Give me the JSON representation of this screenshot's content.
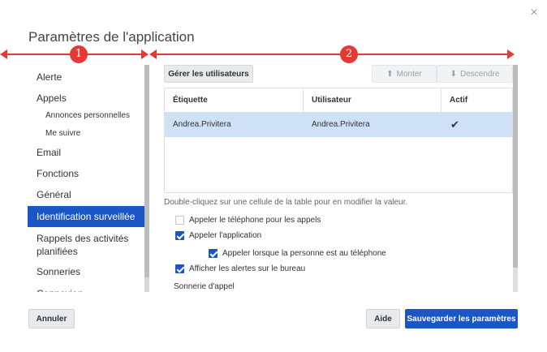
{
  "dialog": {
    "title": "Paramètres de l'application",
    "close_glyph": "×"
  },
  "annotations": [
    {
      "number": "1",
      "color": "#e53935"
    },
    {
      "number": "2",
      "color": "#e53935"
    }
  ],
  "sidebar": {
    "items": [
      {
        "label": "Alerte"
      },
      {
        "label": "Appels"
      },
      {
        "label": "Annonces personnelles"
      },
      {
        "label": "Me suivre"
      },
      {
        "label": "Email"
      },
      {
        "label": "Fonctions"
      },
      {
        "label": "Général"
      },
      {
        "label": "Identification surveillée"
      },
      {
        "label": "Rappels des activités planifiées"
      },
      {
        "label": "Sonneries"
      },
      {
        "label": "Connexion"
      }
    ],
    "active_index": 7,
    "active_color": "#1a56c4"
  },
  "toolbar": {
    "manage_label": "Gérer les utilisateurs",
    "up_label": "Monter",
    "down_label": "Descendre",
    "up_icon": "arrow-up-icon",
    "down_icon": "arrow-down-icon"
  },
  "table": {
    "headers": [
      "Étiquette",
      "Utilisateur",
      "Actif"
    ],
    "rows": [
      {
        "label": "Andrea.Privitera",
        "user": "Andrea.Privitera",
        "active": "✔"
      }
    ],
    "selected_row_color": "#cfe1f7"
  },
  "hint": "Double-cliquez sur une cellule de la table pour en modifier la valeur.",
  "options": [
    {
      "label": "Appeler le téléphone pour les appels",
      "checked": false
    },
    {
      "label": "Appeler l'application",
      "checked": true
    },
    {
      "label": "Appeler lorsque la personne est au téléphone",
      "checked": true
    },
    {
      "label": "Afficher les alertes sur le bureau",
      "checked": true
    }
  ],
  "ring_section": "Sonnerie d'appel",
  "footer": {
    "cancel_label": "Annuler",
    "help_label": "Aide",
    "save_label": "Sauvegarder les paramètres"
  }
}
